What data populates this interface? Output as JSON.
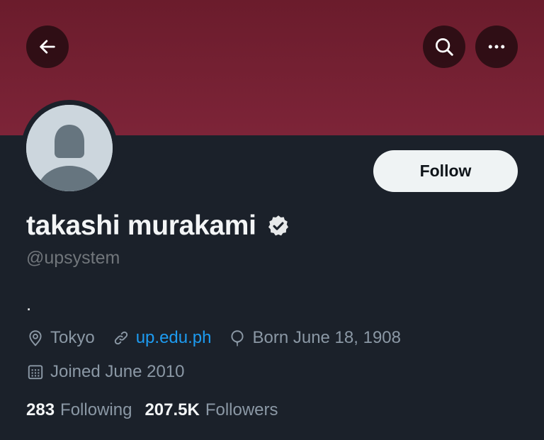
{
  "profile": {
    "display_name": "takashi murakami",
    "handle": "@upsystem",
    "bio": ".",
    "location": "Tokyo",
    "website": "up.edu.ph",
    "birthday": "Born June 18, 1908",
    "joined": "Joined June 2010"
  },
  "actions": {
    "follow_label": "Follow"
  },
  "stats": {
    "following_count": "283",
    "following_label": "Following",
    "followers_count": "207.5K",
    "followers_label": "Followers"
  },
  "icons": {
    "back": "arrow-left-icon",
    "search": "search-icon",
    "more": "more-horizontal-icon",
    "verified": "verified-badge-icon",
    "location": "location-pin-icon",
    "link": "link-icon",
    "birthday": "balloon-icon",
    "calendar": "calendar-icon"
  },
  "colors": {
    "banner": "#7d2438",
    "background": "#1b212a",
    "accent_link": "#1d9bf0",
    "muted_text": "#8b98a5",
    "follow_button_bg": "#eff3f4"
  }
}
